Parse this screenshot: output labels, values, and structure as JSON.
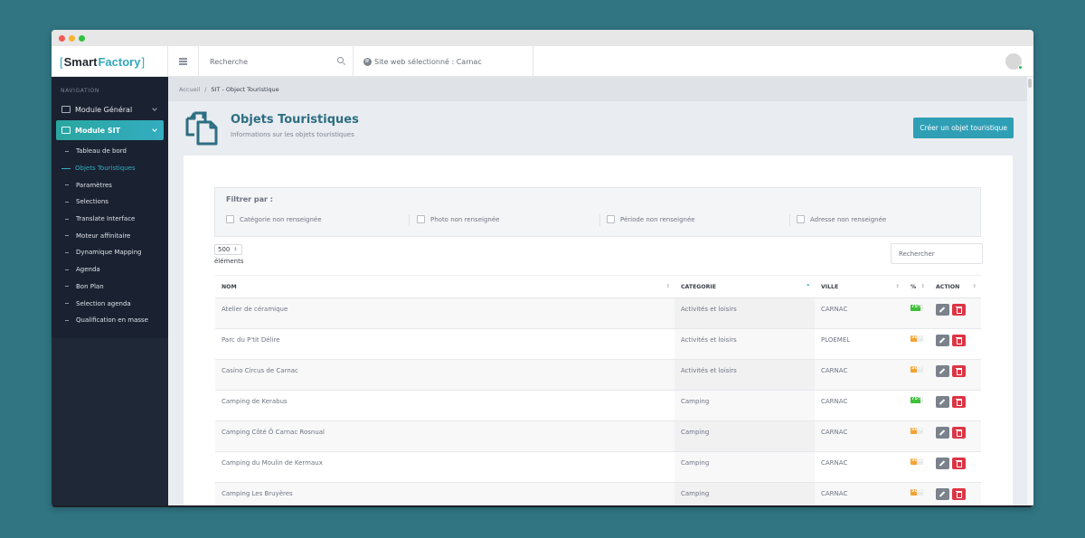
{
  "window": {
    "traffic_lights": [
      "close",
      "minimize",
      "maximize"
    ]
  },
  "topbar": {
    "logo": {
      "bracket_open": "[",
      "word1": "Smart",
      "word2": "Factory",
      "bracket_close": "]"
    },
    "search_placeholder": "Recherche",
    "site_label": "Site web sélectionné : Carnac",
    "user_status_color": "#34b34a"
  },
  "sidebar": {
    "section_label": "NAVIGATION",
    "modules": [
      {
        "label": "Module Général",
        "active": false
      },
      {
        "label": "Module SIT",
        "active": true
      }
    ],
    "sub_items": [
      {
        "label": "Tableau de bord",
        "active": false
      },
      {
        "label": "Objets Touristiques",
        "active": true
      },
      {
        "label": "Paramètres",
        "active": false
      },
      {
        "label": "Selections",
        "active": false
      },
      {
        "label": "Translate Interface",
        "active": false
      },
      {
        "label": "Moteur affinitaire",
        "active": false
      },
      {
        "label": "Dynamique Mapping",
        "active": false
      },
      {
        "label": "Agenda",
        "active": false
      },
      {
        "label": "Bon Plan",
        "active": false
      },
      {
        "label": "Selection agenda",
        "active": false
      },
      {
        "label": "Qualification en masse",
        "active": false
      }
    ]
  },
  "breadcrumb": {
    "home": "Accueil",
    "separator": "/",
    "current": "SIT - Object Touristique"
  },
  "page": {
    "title": "Objets Touristiques",
    "subtitle": "Informations sur les objets touristiques",
    "create_button": "Créer un objet touristique",
    "accent_color": "#2f9fb6"
  },
  "filters": {
    "title": "Filtrer par :",
    "options": [
      {
        "label": "Catégorie non renseignée",
        "checked": false
      },
      {
        "label": "Photo non renseignée",
        "checked": false
      },
      {
        "label": "Période non renseignée",
        "checked": false
      },
      {
        "label": "Adresse non renseignée",
        "checked": false
      }
    ]
  },
  "table": {
    "page_length": "500",
    "page_length_label": "éléments",
    "search_placeholder": "Rechercher",
    "columns": [
      "NOM",
      "CATEGORIE",
      "VILLE",
      "%",
      "ACTION"
    ],
    "sorted_column": "CATEGORIE",
    "rows": [
      {
        "nom": "Atelier de céramique",
        "categorie": "Activités et loisirs",
        "ville": "CARNAC",
        "pct": 75,
        "pct_label": "75%",
        "color": "#3fbf3a"
      },
      {
        "nom": "Parc du P'tit Délire",
        "categorie": "Activités et loisirs",
        "ville": "PLOEMEL",
        "pct": 50,
        "pct_label": "50%",
        "color": "#f3a232"
      },
      {
        "nom": "Casino Circus de Carnac",
        "categorie": "Activités et loisirs",
        "ville": "CARNAC",
        "pct": 50,
        "pct_label": "50%",
        "color": "#f3a232"
      },
      {
        "nom": "Camping de Kerabus",
        "categorie": "Camping",
        "ville": "CARNAC",
        "pct": 75,
        "pct_label": "75%",
        "color": "#3fbf3a"
      },
      {
        "nom": "Camping Côté Ô Carnac Rosnual",
        "categorie": "Camping",
        "ville": "CARNAC",
        "pct": 50,
        "pct_label": "50%",
        "color": "#f3a232"
      },
      {
        "nom": "Camping du Moulin de Kermaux",
        "categorie": "Camping",
        "ville": "CARNAC",
        "pct": 50,
        "pct_label": "50%",
        "color": "#f3a232"
      },
      {
        "nom": "Camping Les Bruyères",
        "categorie": "Camping",
        "ville": "CARNAC",
        "pct": 50,
        "pct_label": "50%",
        "color": "#f3a232"
      }
    ],
    "actions": {
      "edit": "edit",
      "delete": "delete"
    }
  }
}
